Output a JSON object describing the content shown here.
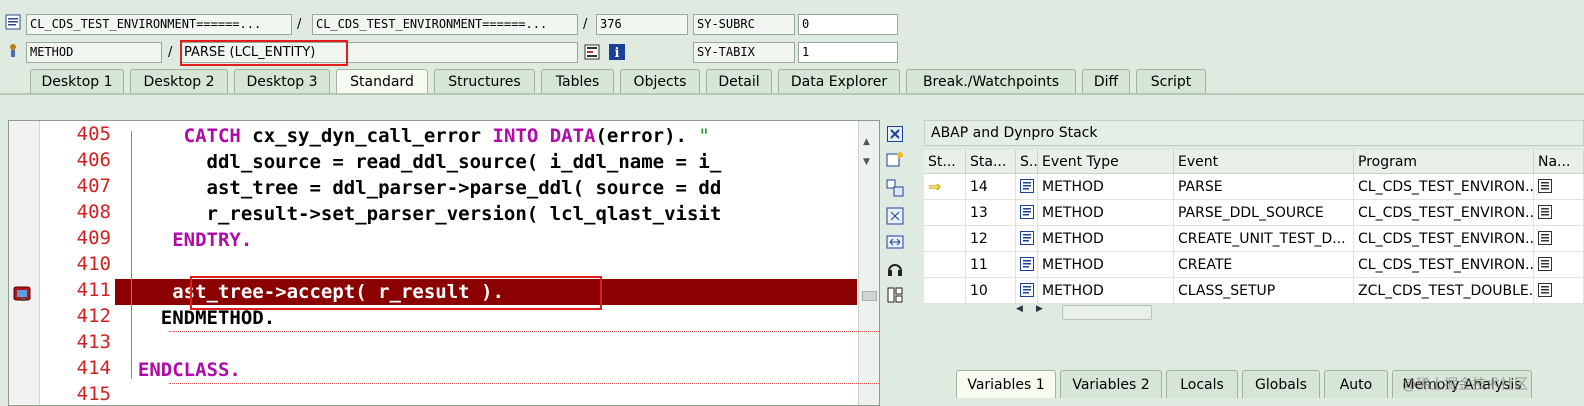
{
  "header": {
    "row1": {
      "program_value": "CL_CDS_TEST_ENVIRONMENT======...",
      "include_value": "CL_CDS_TEST_ENVIRONMENT======...",
      "line_value": "376",
      "sysvar_label": "SY-SUBRC",
      "sysvar_value": "0"
    },
    "row2": {
      "type_value": "METHOD",
      "event_value": "PARSE (LCL_ENTITY)",
      "sysvar_label": "SY-TABIX",
      "sysvar_value": "1"
    },
    "separator": "/"
  },
  "tabs": [
    {
      "label": "Desktop 1",
      "active": false
    },
    {
      "label": "Desktop 2",
      "active": false
    },
    {
      "label": "Desktop 3",
      "active": false
    },
    {
      "label": "Standard",
      "active": true
    },
    {
      "label": "Structures",
      "active": false
    },
    {
      "label": "Tables",
      "active": false
    },
    {
      "label": "Objects",
      "active": false
    },
    {
      "label": "Detail",
      "active": false
    },
    {
      "label": "Data Explorer",
      "active": false
    },
    {
      "label": "Break./Watchpoints",
      "active": false
    },
    {
      "label": "Diff",
      "active": false
    },
    {
      "label": "Script",
      "active": false
    }
  ],
  "editor": {
    "lines": [
      {
        "num": "405",
        "indent": "    ",
        "parts": [
          [
            "kw",
            "CATCH "
          ],
          [
            "id",
            "cx_sy_dyn_call_error "
          ],
          [
            "kw",
            "INTO DATA"
          ],
          [
            "id",
            "(error). "
          ]
        ],
        "tail": "\""
      },
      {
        "num": "406",
        "indent": "      ",
        "parts": [
          [
            "id",
            "ddl_source = read_ddl_source( i_ddl_name = i_"
          ]
        ]
      },
      {
        "num": "407",
        "indent": "      ",
        "parts": [
          [
            "id",
            "ast_tree = ddl_parser->parse_ddl( source = dd"
          ]
        ]
      },
      {
        "num": "408",
        "indent": "      ",
        "parts": [
          [
            "id",
            "r_result->set_parser_version( lcl_qlast_visit"
          ]
        ]
      },
      {
        "num": "409",
        "indent": "   ",
        "parts": [
          [
            "kw",
            "ENDTRY."
          ]
        ]
      },
      {
        "num": "410",
        "indent": "",
        "parts": []
      },
      {
        "num": "411",
        "indent": "   ",
        "parts": [
          [
            "id",
            "ast_tree->accept( r_result )."
          ]
        ],
        "current": true
      },
      {
        "num": "412",
        "indent": "  ",
        "parts": [
          [
            "id",
            "ENDMETHOD."
          ]
        ]
      },
      {
        "num": "413",
        "indent": "",
        "parts": []
      },
      {
        "num": "414",
        "indent": "",
        "parts": [
          [
            "kw",
            "ENDCLASS."
          ]
        ]
      },
      {
        "num": "415",
        "indent": "",
        "parts": []
      }
    ]
  },
  "stack": {
    "title": "ABAP and Dynpro Stack",
    "columns": [
      "St...",
      "Sta...",
      "S...",
      "Event Type",
      "Event",
      "Program",
      "Na..."
    ],
    "rows": [
      {
        "level": "14",
        "type": "METHOD",
        "event": "PARSE",
        "program": "CL_CDS_TEST_ENVIRON...",
        "current": true
      },
      {
        "level": "13",
        "type": "METHOD",
        "event": "PARSE_DDL_SOURCE",
        "program": "CL_CDS_TEST_ENVIRON...",
        "current": false
      },
      {
        "level": "12",
        "type": "METHOD",
        "event": "CREATE_UNIT_TEST_D...",
        "program": "CL_CDS_TEST_ENVIRON...",
        "current": false
      },
      {
        "level": "11",
        "type": "METHOD",
        "event": "CREATE",
        "program": "CL_CDS_TEST_ENVIRON...",
        "current": false
      },
      {
        "level": "10",
        "type": "METHOD",
        "event": "CLASS_SETUP",
        "program": "ZCL_CDS_TEST_DOUBLE...",
        "current": false
      }
    ]
  },
  "bottom_tabs": [
    {
      "label": "Variables 1",
      "active": true
    },
    {
      "label": "Variables 2",
      "active": false
    },
    {
      "label": "Locals",
      "active": false
    },
    {
      "label": "Globals",
      "active": false
    },
    {
      "label": "Auto",
      "active": false
    },
    {
      "label": "Memory Analysis",
      "active": false
    }
  ],
  "watermark": "@稀土掘金技术社区",
  "colors": {
    "current_line": "#8b0000",
    "highlight_box": "#e41c1c",
    "keyword": "#b00aa8",
    "line_number": "#d32020"
  }
}
